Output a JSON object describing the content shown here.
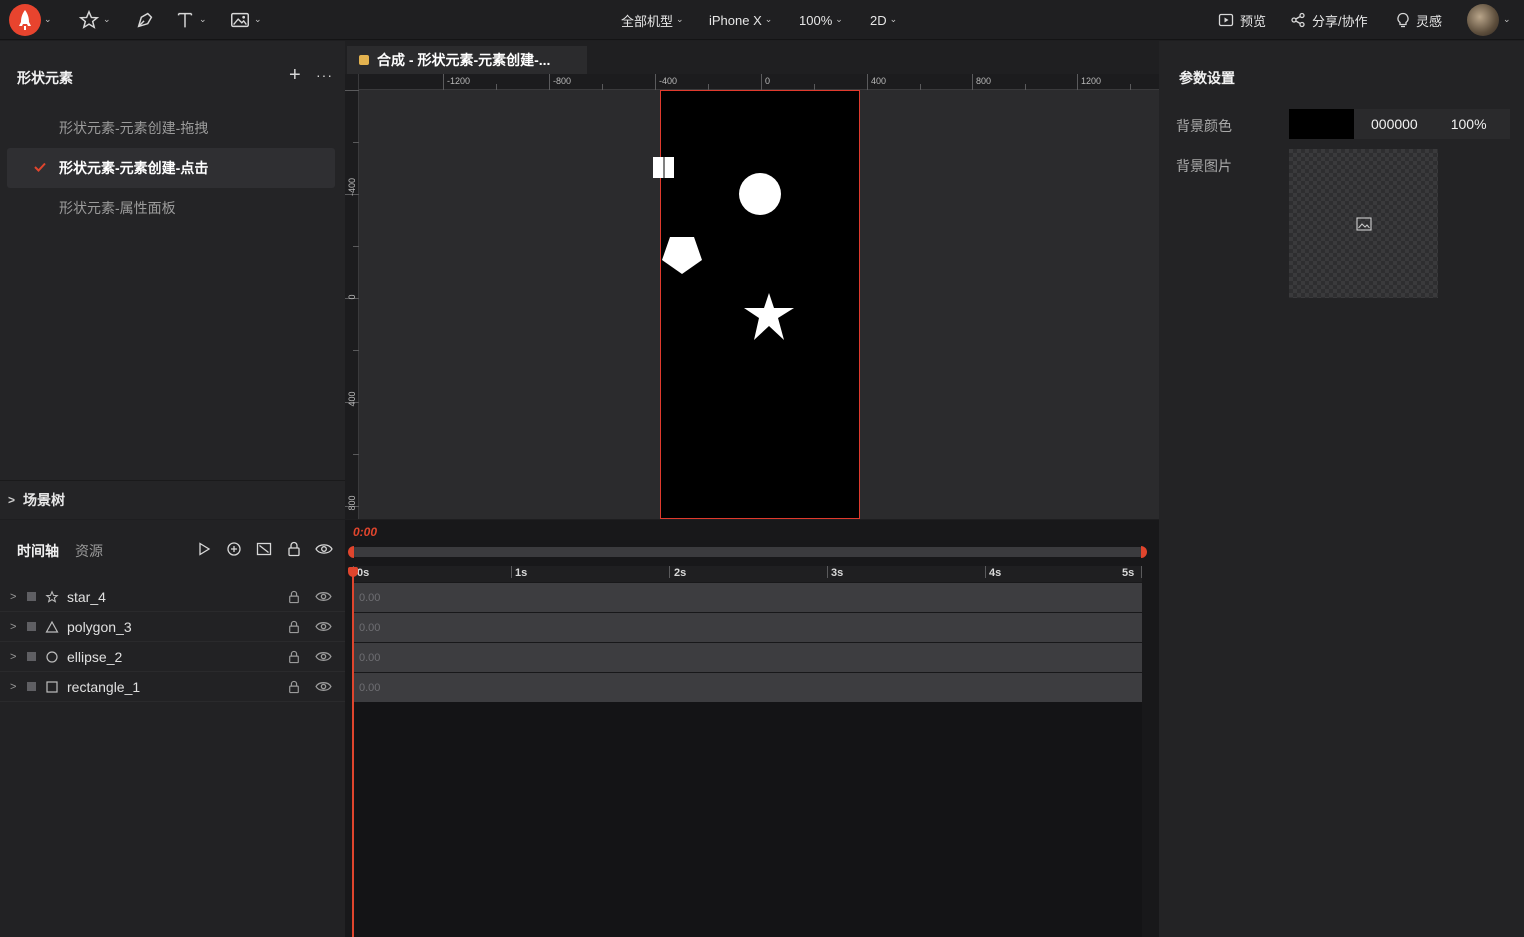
{
  "toolbar": {
    "device_group": "全部机型",
    "device": "iPhone X",
    "zoom": "100%",
    "mode": "2D",
    "preview_label": "预览",
    "share_label": "分享/协作",
    "inspire_label": "灵感"
  },
  "left_panel": {
    "title": "形状元素",
    "items": [
      {
        "label": "形状元素-元素创建-拖拽",
        "active": false
      },
      {
        "label": "形状元素-元素创建-点击",
        "active": true
      },
      {
        "label": "形状元素-属性面板",
        "active": false
      }
    ],
    "scene_tree_label": "场景树"
  },
  "canvas": {
    "tab_title": "合成 - 形状元素-元素创建-...",
    "h_ruler_labels": [
      "-1200",
      "-800",
      "-400",
      "0",
      "400",
      "800",
      "1200"
    ],
    "v_ruler_labels": [
      "-400",
      "0",
      "400",
      "800"
    ],
    "accent_color": "#e03a2d"
  },
  "right_panel": {
    "title": "参数设置",
    "bg_color_label": "背景颜色",
    "bg_color_hex": "000000",
    "bg_color_opacity": "100%",
    "bg_image_label": "背景图片"
  },
  "timeline": {
    "tab_timeline": "时间轴",
    "tab_assets": "资源",
    "current_time": "0:00",
    "seconds": [
      "0s",
      "1s",
      "2s",
      "3s",
      "4s",
      "5s"
    ],
    "layers": [
      {
        "name": "star_4",
        "icon": "star-icon",
        "value": "0.00"
      },
      {
        "name": "polygon_3",
        "icon": "triangle-icon",
        "value": "0.00"
      },
      {
        "name": "ellipse_2",
        "icon": "circle-icon",
        "value": "0.00"
      },
      {
        "name": "rectangle_1",
        "icon": "square-icon",
        "value": "0.00"
      }
    ]
  }
}
